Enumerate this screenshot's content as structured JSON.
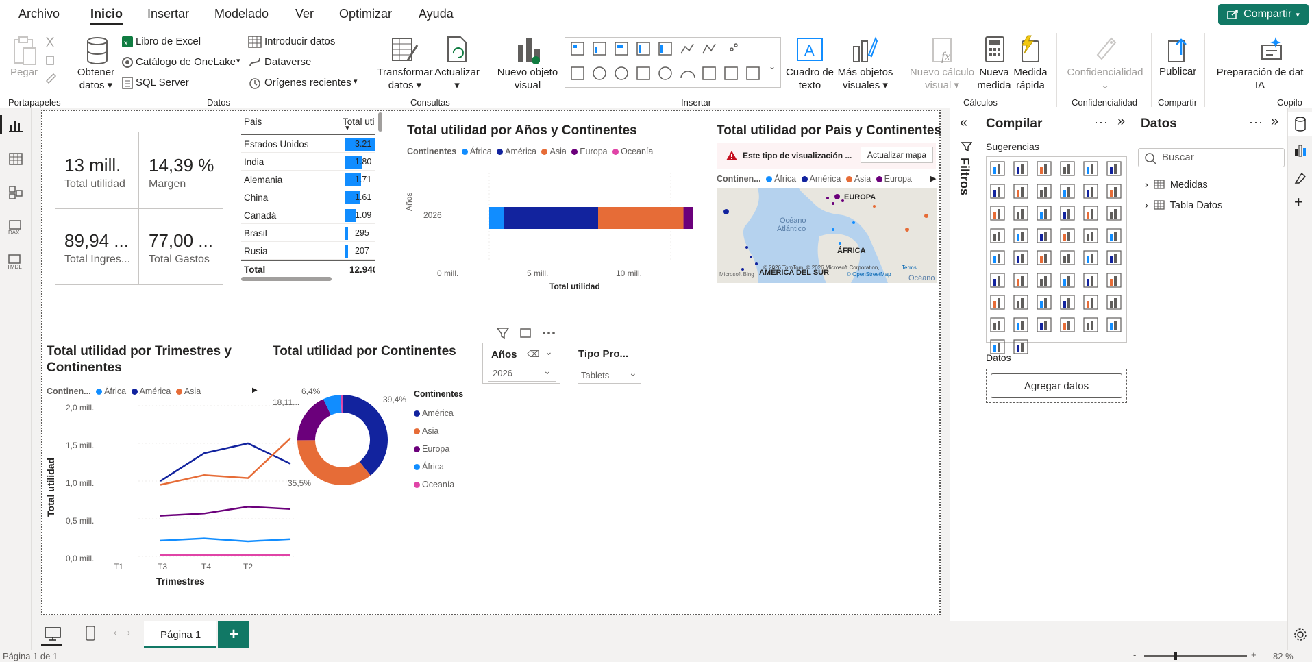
{
  "menu": [
    "Archivo",
    "Inicio",
    "Insertar",
    "Modelado",
    "Ver",
    "Optimizar",
    "Ayuda"
  ],
  "share_label": "Compartir",
  "ribbon": {
    "pegar": "Pegar",
    "portapapeles": "Portapapeles",
    "obtener": [
      "Obtener",
      "datos"
    ],
    "excel": "Libro de Excel",
    "onelake": "Catálogo de OneLake",
    "sql": "SQL Server",
    "introducir": "Introducir datos",
    "dataverse": "Dataverse",
    "origenes": "Orígenes recientes",
    "datos_grp": "Datos",
    "transformar": [
      "Transformar",
      "datos"
    ],
    "actualizar": "Actualizar",
    "consultas": "Consultas",
    "nuevo_objeto": [
      "Nuevo objeto",
      "visual"
    ],
    "cuadro_texto": [
      "Cuadro de",
      "texto"
    ],
    "mas_objetos": [
      "Más objetos",
      "visuales"
    ],
    "insertar": "Insertar",
    "nuevo_calculo": [
      "Nuevo cálculo",
      "visual"
    ],
    "nueva_medida": [
      "Nueva",
      "medida"
    ],
    "medida_rapida": [
      "Medida",
      "rápida"
    ],
    "calculos": "Cálculos",
    "confidencialidad_btn": "Confidencialidad",
    "confidencialidad": "Confidencialidad",
    "publicar": "Publicar",
    "compartir": "Compartir",
    "preparacion": [
      "Preparación de dat",
      "IA"
    ],
    "copilot": "Copilo"
  },
  "kpis": [
    {
      "value": "13 mill.",
      "label": "Total utilidad"
    },
    {
      "value": "14,39 %",
      "label": "Margen"
    },
    {
      "value": "89,94 ...",
      "label": "Total Ingres..."
    },
    {
      "value": "77,00 ...",
      "label": "Total Gastos"
    }
  ],
  "country_table": {
    "headers": [
      "Pais",
      "Total uti"
    ],
    "rows": [
      {
        "name": "Estados Unidos",
        "value": "3.21",
        "pct": 1.0
      },
      {
        "name": "India",
        "value": "1.80",
        "pct": 0.56
      },
      {
        "name": "Alemania",
        "value": "1.71",
        "pct": 0.53
      },
      {
        "name": "China",
        "value": "1.61",
        "pct": 0.5
      },
      {
        "name": "Canadá",
        "value": "1.09",
        "pct": 0.34
      },
      {
        "name": "Brasil",
        "value": "295",
        "pct": 0.09
      },
      {
        "name": "Rusia",
        "value": "207",
        "pct": 0.065
      }
    ],
    "total_label": "Total",
    "total_value": "12.940"
  },
  "colors": {
    "africa": "#118dff",
    "america": "#12239e",
    "asia": "#e66c37",
    "europa": "#6b007b",
    "oceania": "#e044a7"
  },
  "bar_chart": {
    "title": "Total utilidad por Años y Continentes",
    "legend_title": "Continentes",
    "legend": [
      "África",
      "América",
      "Asia",
      "Europa",
      "Oceanía"
    ],
    "ylabel": "Años",
    "category": "2026",
    "xlabel": "Total utilidad",
    "ticks": [
      "0 mill.",
      "5 mill.",
      "10 mill."
    ]
  },
  "map": {
    "title": "Total utilidad por Pais y Continentes",
    "warning": "Este tipo de visualización ...",
    "update_btn": "Actualizar mapa",
    "legend_title": "Continen...",
    "legend": [
      "África",
      "América",
      "Asia",
      "Europa"
    ],
    "labels": {
      "europa": "EUROPA",
      "africa": "ÁFRICA",
      "america_sur": "AMÉRICA DEL SUR",
      "oceano": "Océano",
      "atlantico": "Atlántico",
      "oceano2": "Océano"
    },
    "copyright": "© 2026 TomTom, © 2026 Microsoft Corporation,",
    "terms": "Terms",
    "osm": "© OpenStreetMap",
    "ms": "Microsoft Bing"
  },
  "line_chart": {
    "title1": "Total utilidad por Trimestres y",
    "title2": "Continentes",
    "legend_title": "Continen...",
    "legend": [
      "África",
      "América",
      "Asia"
    ],
    "yticks": [
      "2,0 mill.",
      "1,5 mill.",
      "1,0 mill.",
      "0,5 mill.",
      "0,0 mill."
    ],
    "xticks": [
      "T1",
      "T3",
      "T4",
      "T2"
    ],
    "xlabel": "Trimestres",
    "ylabel": "Total utilidad"
  },
  "chart_data": [
    {
      "type": "bar",
      "title": "Total utilidad por Años y Continentes",
      "categories": [
        "2026"
      ],
      "series": [
        {
          "name": "África",
          "values": [
            0.8
          ]
        },
        {
          "name": "América",
          "values": [
            5.2
          ]
        },
        {
          "name": "Asia",
          "values": [
            4.7
          ]
        },
        {
          "name": "Europa",
          "values": [
            2.4
          ]
        },
        {
          "name": "Oceanía",
          "values": [
            0.1
          ]
        }
      ],
      "xlabel": "Total utilidad",
      "ylabel": "Años",
      "xlim": [
        0,
        13.5
      ]
    },
    {
      "type": "line",
      "title": "Total utilidad por Trimestres y Continentes",
      "x": [
        "T1",
        "T3",
        "T4",
        "T2"
      ],
      "series": [
        {
          "name": "América",
          "values": [
            1.0,
            1.37,
            1.5,
            1.23
          ]
        },
        {
          "name": "Asia",
          "values": [
            0.95,
            1.08,
            1.04,
            1.57
          ]
        },
        {
          "name": "Europa",
          "values": [
            0.54,
            0.57,
            0.66,
            0.63
          ]
        },
        {
          "name": "África",
          "values": [
            0.21,
            0.24,
            0.2,
            0.23
          ]
        },
        {
          "name": "Oceanía",
          "values": [
            0.02,
            0.02,
            0.02,
            0.02
          ]
        }
      ],
      "xlabel": "Trimestres",
      "ylabel": "Total utilidad",
      "ylim": [
        0,
        2.0
      ]
    },
    {
      "type": "pie",
      "title": "Total utilidad por Continentes",
      "categories": [
        "América",
        "Asia",
        "Europa",
        "África",
        "Oceanía"
      ],
      "values": [
        39.4,
        35.5,
        18.1,
        6.4,
        0.6
      ]
    }
  ],
  "donut": {
    "title": "Total utilidad por Continentes",
    "legend_title": "Continentes",
    "legend": [
      "América",
      "Asia",
      "Europa",
      "África",
      "Oceanía"
    ],
    "labels": [
      "39,4%",
      "35,5%",
      "18,11...",
      "6,4%"
    ]
  },
  "slicer_years": {
    "title": "Años",
    "value": "2026"
  },
  "slicer_tipo": {
    "title": "Tipo Pro...",
    "value": "Tablets"
  },
  "filters_label": "Filtros",
  "compilar": {
    "title": "Compilar",
    "sugerencias": "Sugerencias",
    "datos": "Datos",
    "agregar": "Agregar datos"
  },
  "datos_pane": {
    "title": "Datos",
    "search_placeholder": "Buscar",
    "items": [
      "Medidas",
      "Tabla Datos"
    ]
  },
  "page_tab": "Página 1",
  "status": {
    "page": "Página 1 de 1",
    "zoom": "82 %"
  }
}
